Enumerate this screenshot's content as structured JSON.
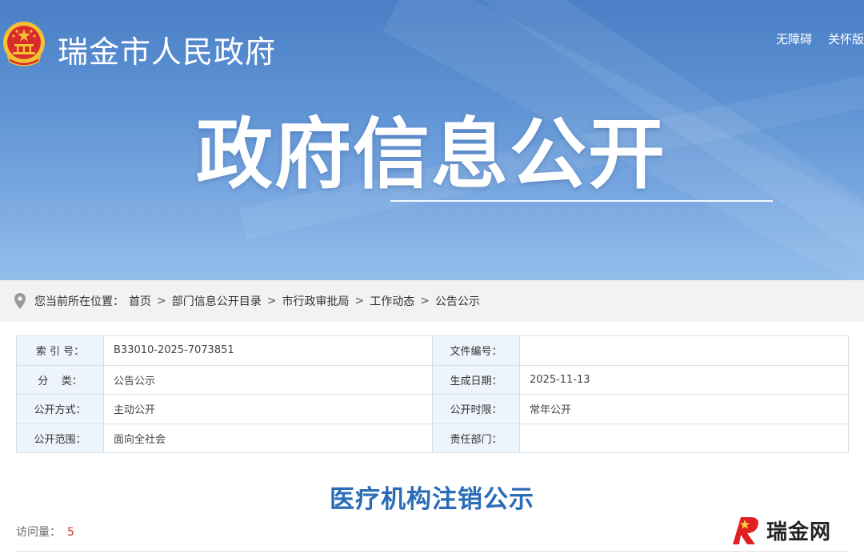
{
  "header": {
    "site_name": "瑞金市人民政府",
    "top_links": [
      "无障碍",
      "关怀版"
    ],
    "hero_title": "政府信息公开",
    "colors": {
      "banner_top": "#4a7fc6",
      "banner_bottom": "#93bdea"
    }
  },
  "breadcrumb": {
    "prefix": "您当前所在位置：",
    "items": [
      "首页",
      "部门信息公开目录",
      "市行政审批局",
      "工作动态",
      "公告公示"
    ],
    "separator": ">"
  },
  "info": {
    "rows": [
      {
        "label": "索 引 号：",
        "value": "B33010-2025-7073851",
        "label2": "文件编号：",
        "value2": ""
      },
      {
        "label": "分    类：",
        "value": "公告公示",
        "label2": "生成日期：",
        "value2": "2025-11-13"
      },
      {
        "label": "公开方式：",
        "value": "主动公开",
        "label2": "公开时限：",
        "value2": "常年公开"
      },
      {
        "label": "公开范围：",
        "value": "面向全社会",
        "label2": "责任部门：",
        "value2": ""
      }
    ]
  },
  "article": {
    "title": "医疗机构注销公示",
    "visits_label": "访问量：",
    "visits_count": "5",
    "title_color": "#2b6cb8"
  },
  "watermark": {
    "text": "瑞金网"
  }
}
